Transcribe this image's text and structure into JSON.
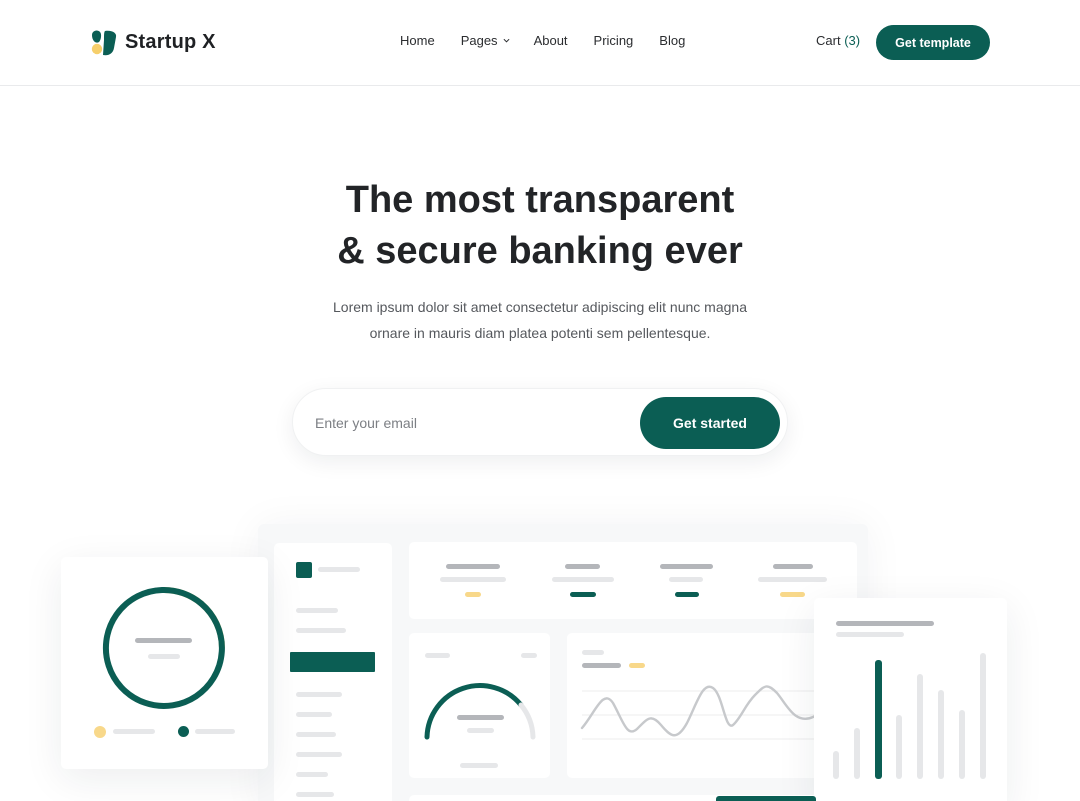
{
  "brand": {
    "name": "Startup X",
    "accent": "#0b5e54",
    "accent_light": "#f8d88a"
  },
  "nav": {
    "items": [
      {
        "label": "Home"
      },
      {
        "label": "Pages",
        "icon": "chevron-down-icon"
      },
      {
        "label": "About"
      },
      {
        "label": "Pricing"
      },
      {
        "label": "Blog"
      }
    ],
    "cart_label": "Cart",
    "cart_count": "(3)",
    "cta_label": "Get template"
  },
  "hero": {
    "title_line1": "The most transparent",
    "title_line2": "& secure banking ever",
    "subtitle_line1": "Lorem ipsum dolor sit amet consectetur adipiscing elit nunc magna",
    "subtitle_line2": "ornare in mauris diam platea potenti sem pellentesque.",
    "email_placeholder": "Enter your email",
    "cta_label": "Get started"
  }
}
